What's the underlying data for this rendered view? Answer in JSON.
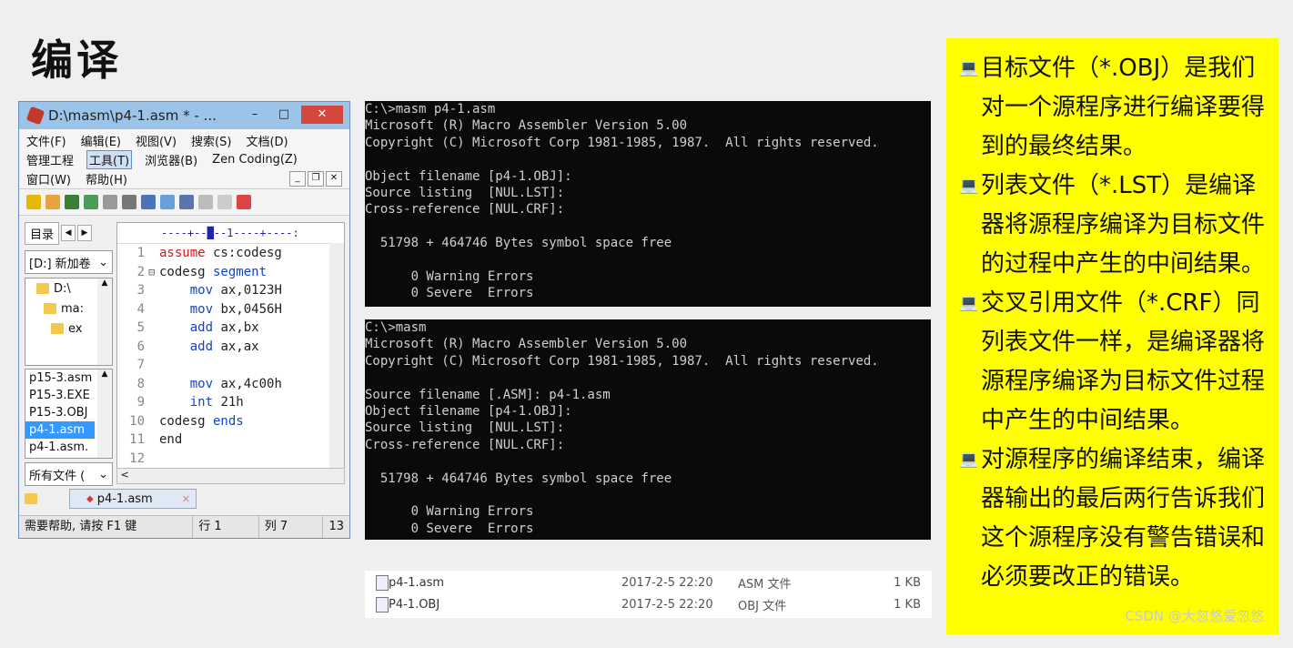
{
  "slide_title": "编译",
  "editor": {
    "window_title": "D:\\masm\\p4-1.asm * - ...",
    "min_glyph": "–",
    "max_glyph": "□",
    "close_glyph": "✕",
    "menu_row1": [
      "文件(F)",
      "编辑(E)",
      "视图(V)",
      "搜索(S)",
      "文档(D)"
    ],
    "menu_row2": [
      "管理工程",
      "工具(T)",
      "浏览器(B)",
      "Zen Coding(Z)"
    ],
    "menu_row3": [
      "窗口(W)",
      "帮助(H)"
    ],
    "tab_label": "目录",
    "drive_select": "[D:] 新加卷",
    "tree_items": [
      "D:\\",
      "ma:",
      "ex"
    ],
    "files": [
      "p15-3.asm",
      "P15-3.EXE",
      "P15-3.OBJ",
      "p4-1.asm",
      "p4-1.asm."
    ],
    "filter_select": "所有文件 (",
    "ruler": "----+--█--1----+----:",
    "code_lines": [
      {
        "n": "1",
        "a": "assume",
        "b": " cs:codesg"
      },
      {
        "n": "2",
        "a": "codesg",
        "b": " segment"
      },
      {
        "n": "3",
        "a": "    mov",
        "b": " ax,0123H"
      },
      {
        "n": "4",
        "a": "    mov",
        "b": " bx,0456H"
      },
      {
        "n": "5",
        "a": "    add",
        "b": " ax,bx"
      },
      {
        "n": "6",
        "a": "    add",
        "b": " ax,ax"
      },
      {
        "n": "7",
        "a": "",
        "b": ""
      },
      {
        "n": "8",
        "a": "    mov",
        "b": " ax,4c00h"
      },
      {
        "n": "9",
        "a": "    int",
        "b": " 21h"
      },
      {
        "n": "10",
        "a": "codesg",
        "b": " ends"
      },
      {
        "n": "11",
        "a": "end",
        "b": ""
      },
      {
        "n": "12",
        "a": "",
        "b": ""
      }
    ],
    "doc_tab": "p4-1.asm",
    "status": {
      "help": "需要帮助, 请按 F1 键",
      "row": "行 1",
      "col": "列 7",
      "num": "13"
    }
  },
  "terminal1": "C:\\>masm p4-1.asm\nMicrosoft (R) Macro Assembler Version 5.00\nCopyright (C) Microsoft Corp 1981-1985, 1987.  All rights reserved.\n\nObject filename [p4-1.OBJ]:\nSource listing  [NUL.LST]:\nCross-reference [NUL.CRF]:\n\n  51798 + 464746 Bytes symbol space free\n\n      0 Warning Errors\n      0 Severe  Errors",
  "terminal2": "C:\\>masm\nMicrosoft (R) Macro Assembler Version 5.00\nCopyright (C) Microsoft Corp 1981-1985, 1987.  All rights reserved.\n\nSource filename [.ASM]: p4-1.asm\nObject filename [p4-1.OBJ]:\nSource listing  [NUL.LST]:\nCross-reference [NUL.CRF]:\n\n  51798 + 464746 Bytes symbol space free\n\n      0 Warning Errors\n      0 Severe  Errors",
  "explorer": [
    {
      "name": "p4-1.asm",
      "date": "2017-2-5 22:20",
      "type": "ASM 文件",
      "size": "1 KB"
    },
    {
      "name": "P4-1.OBJ",
      "date": "2017-2-5 22:20",
      "type": "OBJ 文件",
      "size": "1 KB"
    }
  ],
  "notes": [
    "目标文件（*.OBJ）是我们对一个源程序进行编译要得到的最终结果。",
    "列表文件（*.LST）是编译器将源程序编译为目标文件的过程中产生的中间结果。",
    "交叉引用文件（*.CRF）同列表文件一样，是编译器将源程序编译为目标文件过程中产生的中间结果。",
    "对源程序的编译结束，编译器输出的最后两行告诉我们这个源程序没有警告错误和必须要改正的错误。"
  ],
  "bullet_glyph": "💻",
  "watermark": "CSDN @大忽悠爱忽悠"
}
